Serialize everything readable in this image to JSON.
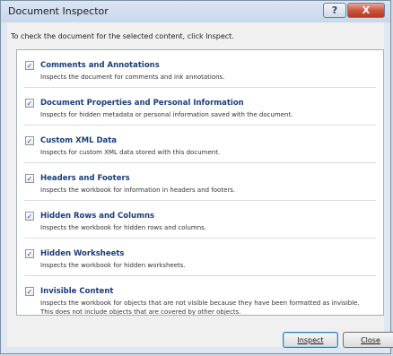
{
  "window": {
    "title": "Document Inspector",
    "help_label": "?",
    "close_label": "X"
  },
  "instruction": "To check the document for the selected content, click Inspect.",
  "items": [
    {
      "checked": true,
      "title": "Comments and Annotations",
      "description": "Inspects the document for comments and ink annotations."
    },
    {
      "checked": true,
      "title": "Document Properties and Personal Information",
      "description": "Inspects for hidden metadata or personal information saved with the document."
    },
    {
      "checked": true,
      "title": "Custom XML Data",
      "description": "Inspects for custom XML data stored with this document."
    },
    {
      "checked": true,
      "title": "Headers and Footers",
      "description": "Inspects the workbook for information in headers and footers."
    },
    {
      "checked": true,
      "title": "Hidden Rows and Columns",
      "description": "Inspects the workbook for hidden rows and columns."
    },
    {
      "checked": true,
      "title": "Hidden Worksheets",
      "description": "Inspects the workbook for hidden worksheets."
    },
    {
      "checked": true,
      "title": "Invisible Content",
      "description": "Inspects the workbook for objects that are not visible because they have been formatted as invisible. This does not include objects that are covered by other objects."
    }
  ],
  "buttons": {
    "inspect": "Inspect",
    "close": "Close"
  }
}
